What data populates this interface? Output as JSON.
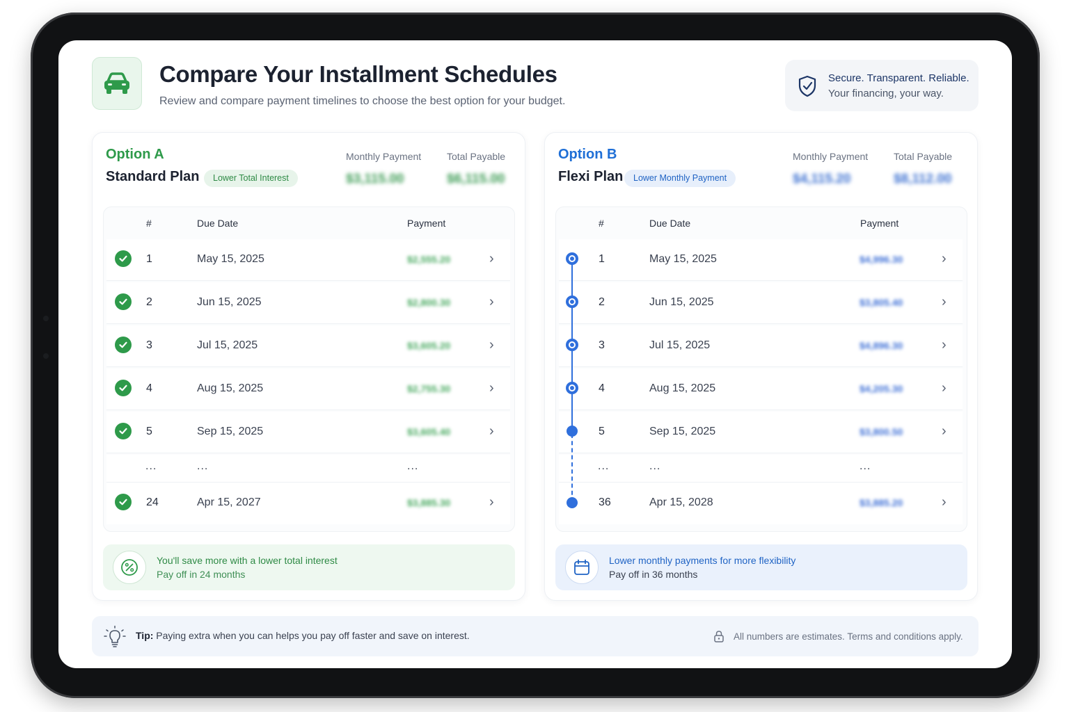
{
  "header": {
    "title": "Compare Your Installment Schedules",
    "subtitle": "Review and compare payment timelines to choose the best option for your budget.",
    "secure_line1": "Secure. Transparent. Reliable.",
    "secure_line2": "Your financing, your way."
  },
  "option_a": {
    "label": "Option A",
    "plan": "Standard Plan",
    "badge": "Lower Total Interest",
    "monthly_label": "Monthly Payment",
    "total_label": "Total Payable",
    "monthly_value": "$3,115.00",
    "total_value": "$6,115.00",
    "columns": {
      "num": "#",
      "date": "Due Date",
      "payment": "Payment"
    },
    "rows": [
      {
        "num": "1",
        "date": "May 15, 2025",
        "payment": "$2,555.20"
      },
      {
        "num": "2",
        "date": "Jun 15, 2025",
        "payment": "$2,800.30"
      },
      {
        "num": "3",
        "date": "Jul 15, 2025",
        "payment": "$3,605.20"
      },
      {
        "num": "4",
        "date": "Aug 15, 2025",
        "payment": "$2,755.30"
      },
      {
        "num": "5",
        "date": "Sep 15, 2025",
        "payment": "$3,605.40"
      },
      {
        "num": "24",
        "date": "Apr 15, 2027",
        "payment": "$3,885.30"
      }
    ],
    "ellipsis": "...",
    "note_line1": "You'll save more with a lower total interest",
    "note_line2": "Pay off in 24 months"
  },
  "option_b": {
    "label": "Option B",
    "plan": "Flexi Plan",
    "badge": "Lower Monthly Payment",
    "monthly_label": "Monthly Payment",
    "total_label": "Total Payable",
    "monthly_value": "$4,115.20",
    "total_value": "$8,112.00",
    "columns": {
      "num": "#",
      "date": "Due Date",
      "payment": "Payment"
    },
    "rows": [
      {
        "num": "1",
        "date": "May 15, 2025",
        "payment": "$4,996.30"
      },
      {
        "num": "2",
        "date": "Jun 15, 2025",
        "payment": "$3,805.40"
      },
      {
        "num": "3",
        "date": "Jul 15, 2025",
        "payment": "$4,896.30"
      },
      {
        "num": "4",
        "date": "Aug 15, 2025",
        "payment": "$4,205.30"
      },
      {
        "num": "5",
        "date": "Sep 15, 2025",
        "payment": "$3,800.50"
      },
      {
        "num": "36",
        "date": "Apr 15, 2028",
        "payment": "$3,885.20"
      }
    ],
    "ellipsis": "...",
    "note_line1": "Lower monthly payments for more flexibility",
    "note_line2": "Pay off in 36 months"
  },
  "footer": {
    "tip_label": "Tip:",
    "tip_text": "Paying extra when you can helps you pay off faster and save on interest.",
    "disclaimer": "All numbers are estimates. Terms and conditions apply."
  },
  "colors": {
    "accent_green": "#2e9a4a",
    "accent_blue": "#2f6fdc",
    "title": "#1c2230"
  },
  "icons": {
    "app": "car-icon",
    "secure": "shield-check-icon",
    "paid": "check-circle-icon",
    "row": "chevron-right-icon",
    "note_a": "percent-icon",
    "note_b": "calendar-icon",
    "tip": "lightbulb-icon",
    "disclaimer": "lock-icon"
  }
}
